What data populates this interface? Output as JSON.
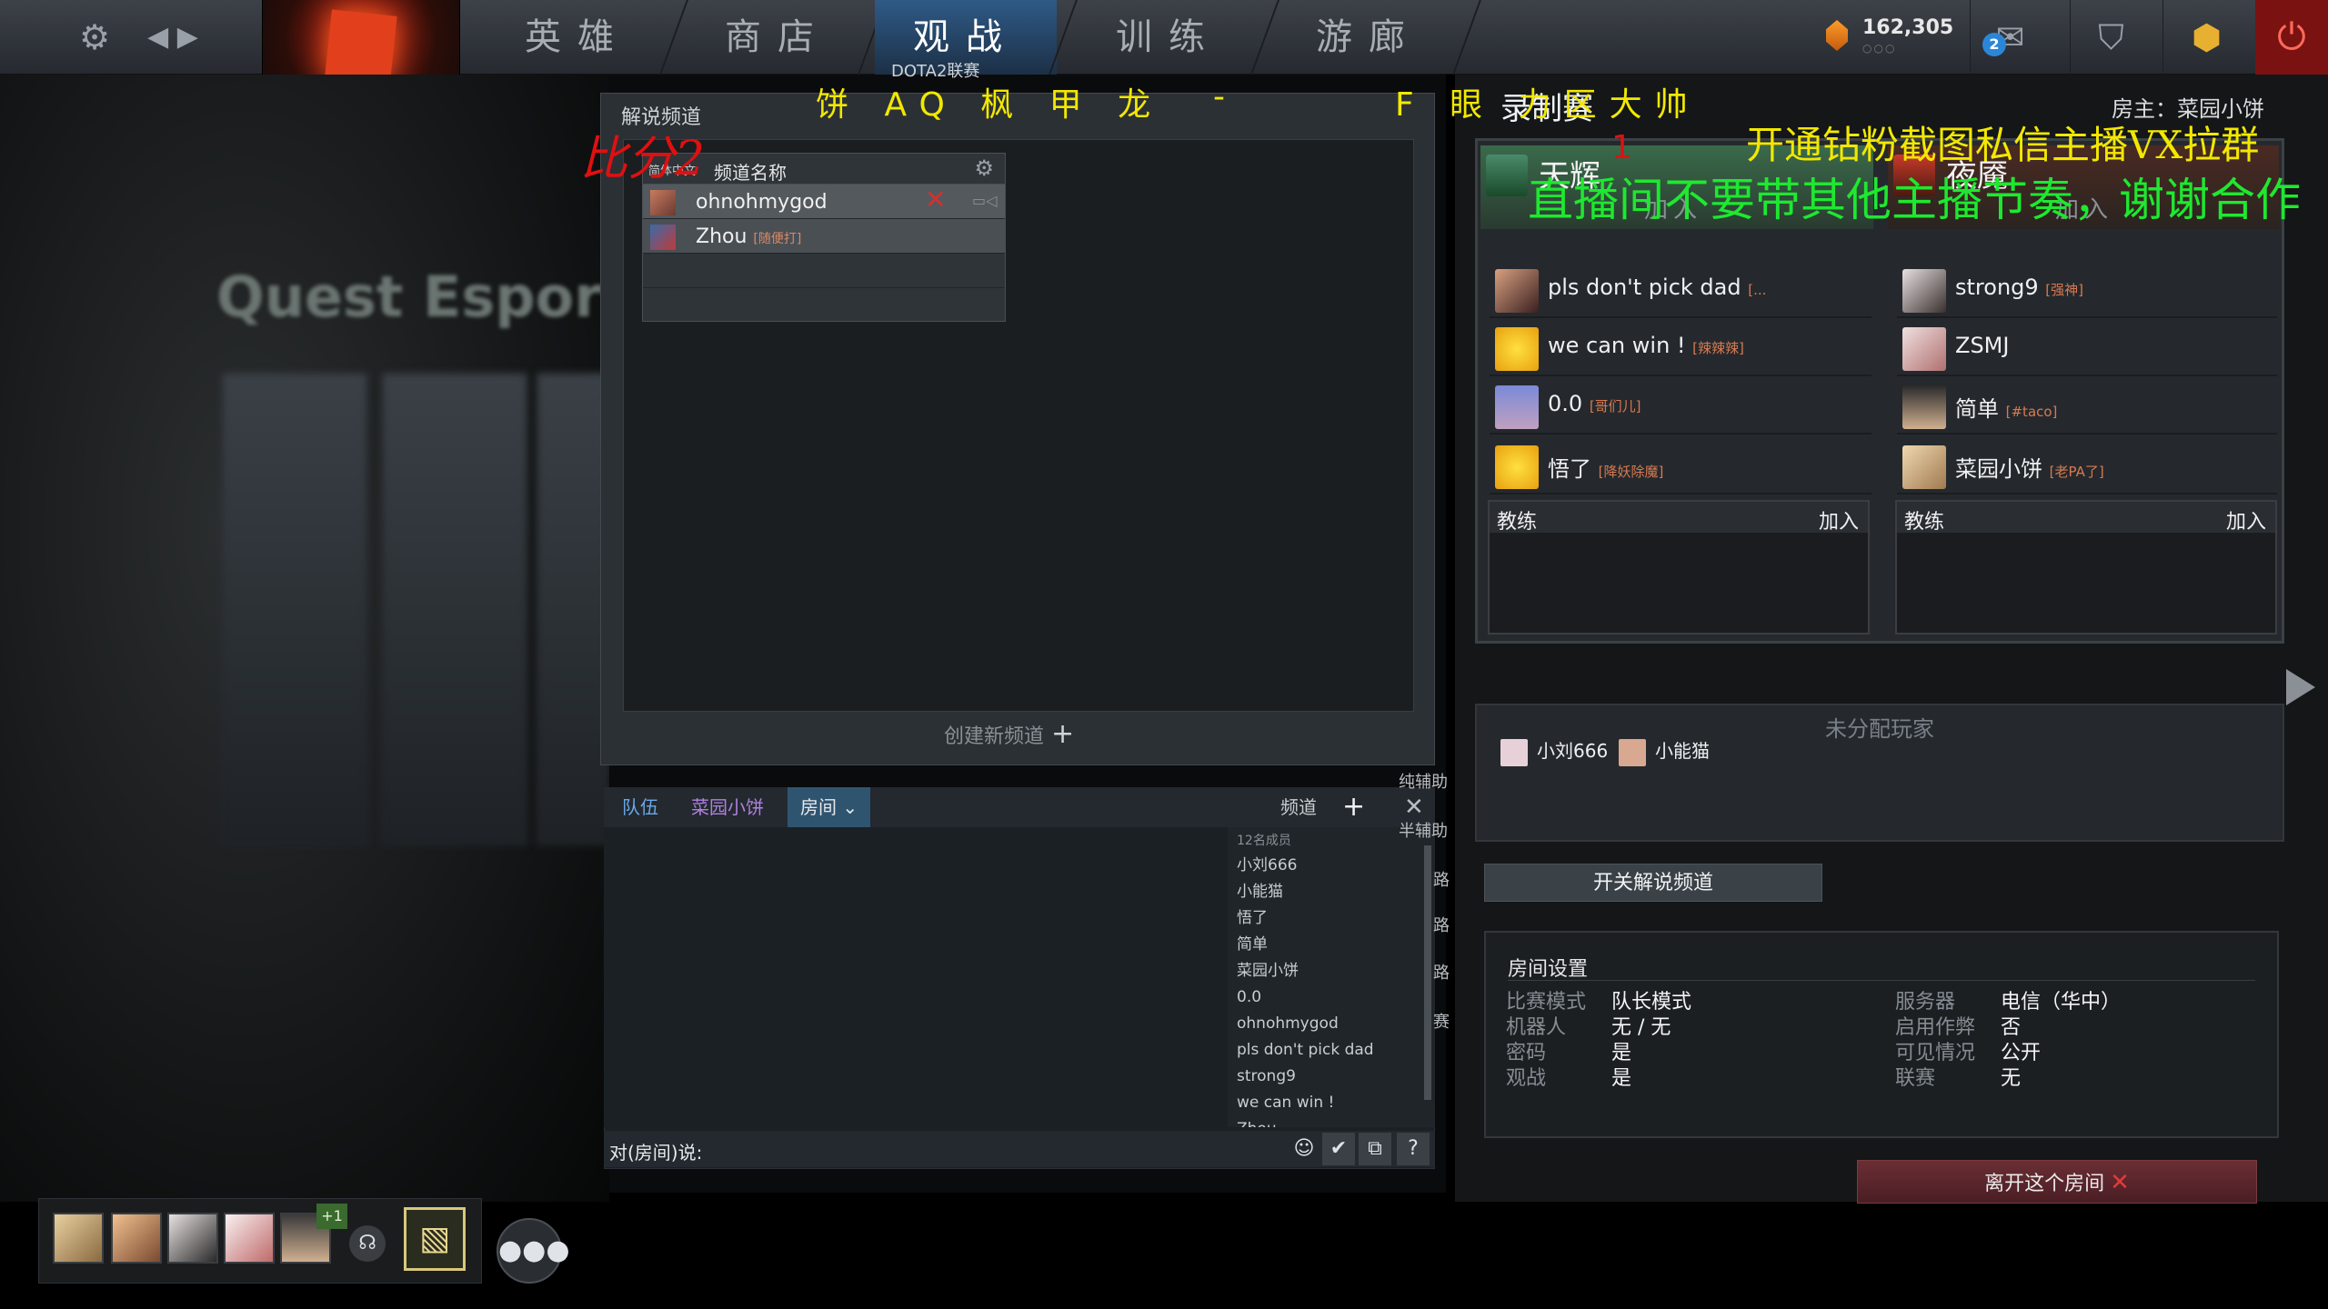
{
  "topbar": {
    "tabs": [
      {
        "label": "英雄"
      },
      {
        "label": "商店"
      },
      {
        "label": "观战"
      },
      {
        "label": "训练"
      },
      {
        "label": "游廊"
      }
    ],
    "active_tab": "观战",
    "currency": {
      "amount": "162,305",
      "dots": "○○○"
    },
    "mail_count": "2"
  },
  "overlay": {
    "score_label": "比分2",
    "team_left": "饼 AQ 枫 甲 龙",
    "dash": "-",
    "team_right": "F 眼 力区大帅",
    "promo": "开通钻粉截图私信主播VX拉群",
    "notice": "直播间不要带其他主播节奏，谢谢合作",
    "mark_one": "1",
    "league_badge": "DOTA2联赛"
  },
  "broadcast": {
    "title": "解说频道",
    "table_lang": "简体中文",
    "table_name_header": "频道名称",
    "rows": [
      {
        "name": "ohnohmygod",
        "tag": ""
      },
      {
        "name": "Zhou",
        "tag": "[随便打]"
      }
    ],
    "create_label": "创建新频道"
  },
  "room": {
    "title": "录制赛",
    "owner": "房主：菜园小饼",
    "radiant": {
      "label": "天辉",
      "join": "加入"
    },
    "dire": {
      "label": "夜魇",
      "join": "加入"
    },
    "radiant_players": [
      {
        "name": "pls don't pick dad",
        "tag": "[..."
      },
      {
        "name": "we can win !",
        "tag": "[辣辣辣]"
      },
      {
        "name": "0.0",
        "tag": "[哥们儿]"
      },
      {
        "name": "悟了",
        "tag": "[降妖除魔]"
      }
    ],
    "dire_players": [
      {
        "name": "strong9",
        "tag": "[强神]"
      },
      {
        "name": "ZSMJ",
        "tag": ""
      },
      {
        "name": "简单",
        "tag": "[#taco]"
      },
      {
        "name": "菜园小饼",
        "tag": "[老PA了]"
      }
    ],
    "coach_label": "教练",
    "coach_join": "加入",
    "unassigned_title": "未分配玩家",
    "unassigned": [
      "小刘666",
      "小能猫"
    ],
    "toggle_broadcast": "开关解说频道",
    "settings_title": "房间设置",
    "settings_left": [
      {
        "k": "比赛模式",
        "v": "队长模式"
      },
      {
        "k": "机器人",
        "v": "无 / 无"
      },
      {
        "k": "密码",
        "v": "是"
      },
      {
        "k": "观战",
        "v": "是"
      }
    ],
    "settings_right": [
      {
        "k": "服务器",
        "v": "电信（华中）"
      },
      {
        "k": "启用作弊",
        "v": "否"
      },
      {
        "k": "可见情况",
        "v": "公开"
      },
      {
        "k": "联赛",
        "v": "无"
      }
    ],
    "leave_label": "离开这个房间"
  },
  "chat": {
    "tabs": [
      "队伍",
      "菜园小饼",
      "房间"
    ],
    "channel_label": "频道",
    "member_count": "12名成员",
    "members": [
      "小刘666",
      "小能猫",
      "悟了",
      "简单",
      "菜园小饼",
      "0.0",
      "ohnohmygod",
      "pls don't pick dad",
      "strong9",
      "we can win !",
      "Zhou"
    ],
    "input_label": "对(房间)说:",
    "side_labels": [
      "纯辅助",
      "半辅助",
      "路",
      "路",
      "路",
      "赛"
    ],
    "help": "?"
  },
  "party": {
    "plus": "+1"
  },
  "bg": {
    "logo_text": "Quest Espor"
  },
  "colors": {
    "overlay_yellow": "#f2e800",
    "overlay_green": "#1ee830",
    "overlay_red": "#e01010",
    "active_tab": "#2f5a86"
  }
}
